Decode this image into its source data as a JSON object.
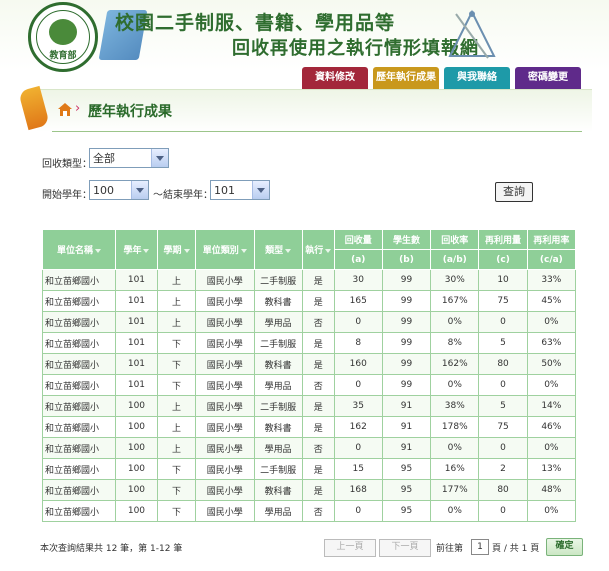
{
  "header": {
    "title_line1": "校園二手制服、書籍、學用品等",
    "title_line2": "回收再使用之執行情形填報網",
    "seal_text": "教育部",
    "nav": [
      {
        "label": "資料修改",
        "color": "#a3273a"
      },
      {
        "label": "歷年執行成果",
        "color": "#c9981c"
      },
      {
        "label": "與我聯絡",
        "color": "#1e9aa8"
      },
      {
        "label": "密碼變更",
        "color": "#5f2a8a"
      }
    ]
  },
  "page": {
    "breadcrumb_sep": "›",
    "title": "歷年執行成果"
  },
  "filters": {
    "type_label": "回收類型：",
    "type_value": "全部",
    "start_label": "開始學年：",
    "start_value": "100",
    "tilde": "～",
    "end_label": "結束學年：",
    "end_value": "101",
    "query_label": "查詢"
  },
  "table": {
    "headers": {
      "unit": "單位名稱",
      "year": "學年",
      "term": "學期",
      "level": "單位類別",
      "kind": "類型",
      "done": "執行",
      "recycled": "回收量",
      "recycled_sub": "(a)",
      "students": "學生數",
      "students_sub": "(b)",
      "rate": "回收率",
      "rate_sub": "(a/b)",
      "reuse": "再利用量",
      "reuse_sub": "(c)",
      "reuse_rate": "再利用率",
      "reuse_rate_sub": "(c/a)"
    },
    "rows": [
      {
        "unit": "和立苗鄉國小",
        "year": "101",
        "term": "上",
        "level": "國民小學",
        "kind": "二手制服",
        "done": "是",
        "recycled": "30",
        "students": "99",
        "rate": "30%",
        "reuse": "10",
        "reuse_rate": "33%"
      },
      {
        "unit": "和立苗鄉國小",
        "year": "101",
        "term": "上",
        "level": "國民小學",
        "kind": "教科書",
        "done": "是",
        "recycled": "165",
        "students": "99",
        "rate": "167%",
        "reuse": "75",
        "reuse_rate": "45%"
      },
      {
        "unit": "和立苗鄉國小",
        "year": "101",
        "term": "上",
        "level": "國民小學",
        "kind": "學用品",
        "done": "否",
        "recycled": "0",
        "students": "99",
        "rate": "0%",
        "reuse": "0",
        "reuse_rate": "0%"
      },
      {
        "unit": "和立苗鄉國小",
        "year": "101",
        "term": "下",
        "level": "國民小學",
        "kind": "二手制服",
        "done": "是",
        "recycled": "8",
        "students": "99",
        "rate": "8%",
        "reuse": "5",
        "reuse_rate": "63%"
      },
      {
        "unit": "和立苗鄉國小",
        "year": "101",
        "term": "下",
        "level": "國民小學",
        "kind": "教科書",
        "done": "是",
        "recycled": "160",
        "students": "99",
        "rate": "162%",
        "reuse": "80",
        "reuse_rate": "50%"
      },
      {
        "unit": "和立苗鄉國小",
        "year": "101",
        "term": "下",
        "level": "國民小學",
        "kind": "學用品",
        "done": "否",
        "recycled": "0",
        "students": "99",
        "rate": "0%",
        "reuse": "0",
        "reuse_rate": "0%"
      },
      {
        "unit": "和立苗鄉國小",
        "year": "100",
        "term": "上",
        "level": "國民小學",
        "kind": "二手制服",
        "done": "是",
        "recycled": "35",
        "students": "91",
        "rate": "38%",
        "reuse": "5",
        "reuse_rate": "14%"
      },
      {
        "unit": "和立苗鄉國小",
        "year": "100",
        "term": "上",
        "level": "國民小學",
        "kind": "教科書",
        "done": "是",
        "recycled": "162",
        "students": "91",
        "rate": "178%",
        "reuse": "75",
        "reuse_rate": "46%"
      },
      {
        "unit": "和立苗鄉國小",
        "year": "100",
        "term": "上",
        "level": "國民小學",
        "kind": "學用品",
        "done": "否",
        "recycled": "0",
        "students": "91",
        "rate": "0%",
        "reuse": "0",
        "reuse_rate": "0%"
      },
      {
        "unit": "和立苗鄉國小",
        "year": "100",
        "term": "下",
        "level": "國民小學",
        "kind": "二手制服",
        "done": "是",
        "recycled": "15",
        "students": "95",
        "rate": "16%",
        "reuse": "2",
        "reuse_rate": "13%"
      },
      {
        "unit": "和立苗鄉國小",
        "year": "100",
        "term": "下",
        "level": "國民小學",
        "kind": "教科書",
        "done": "是",
        "recycled": "168",
        "students": "95",
        "rate": "177%",
        "reuse": "80",
        "reuse_rate": "48%"
      },
      {
        "unit": "和立苗鄉國小",
        "year": "100",
        "term": "下",
        "level": "國民小學",
        "kind": "學用品",
        "done": "否",
        "recycled": "0",
        "students": "95",
        "rate": "0%",
        "reuse": "0",
        "reuse_rate": "0%"
      }
    ]
  },
  "pagination": {
    "summary": "本次查詢結果共 12 筆，第 1-12 筆",
    "prev_label": "上一頁",
    "next_label": "下一頁",
    "goto_prefix": "前往第",
    "page_value": "1",
    "goto_suffix": "頁 / 共 1 頁",
    "confirm_label": "確定"
  }
}
